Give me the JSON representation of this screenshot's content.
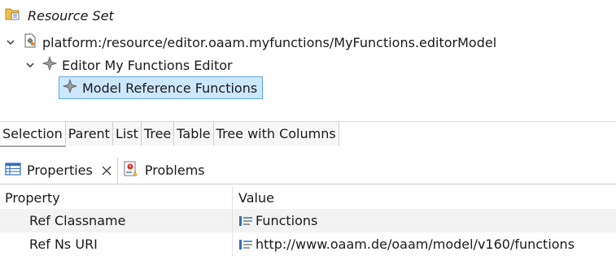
{
  "resource_set": {
    "title": "Resource Set",
    "icon": "folder-resource-icon"
  },
  "tree": {
    "root": {
      "label": "platform:/resource/editor.oaam.myfunctions/MyFunctions.editorModel",
      "expanded": true,
      "icon": "model-file-icon"
    },
    "child": {
      "label": "Editor My Functions Editor",
      "expanded": true,
      "icon": "diamond-node-icon"
    },
    "grandchild": {
      "label": "Model Reference Functions",
      "selected": true,
      "icon": "diamond-node-icon"
    }
  },
  "viewer_tabs": [
    "Selection",
    "Parent",
    "List",
    "Tree",
    "Table",
    "Tree with Columns"
  ],
  "views": {
    "properties": {
      "label": "Properties",
      "icon": "properties-table-icon",
      "active": true
    },
    "problems": {
      "label": "Problems",
      "icon": "problems-icon"
    }
  },
  "properties_table": {
    "headers": {
      "property": "Property",
      "value": "Value"
    },
    "rows": [
      {
        "property": "Ref Classname",
        "value": "Functions"
      },
      {
        "property": "Ref Ns URI",
        "value": "http://www.oaam.de/oaam/model/v160/functions"
      }
    ]
  },
  "colors": {
    "selection_bg": "#cce8ff",
    "selection_border": "#5fa8e0",
    "folder_yellow": "#f0c24a",
    "icon_blue": "#2f6fbf"
  }
}
